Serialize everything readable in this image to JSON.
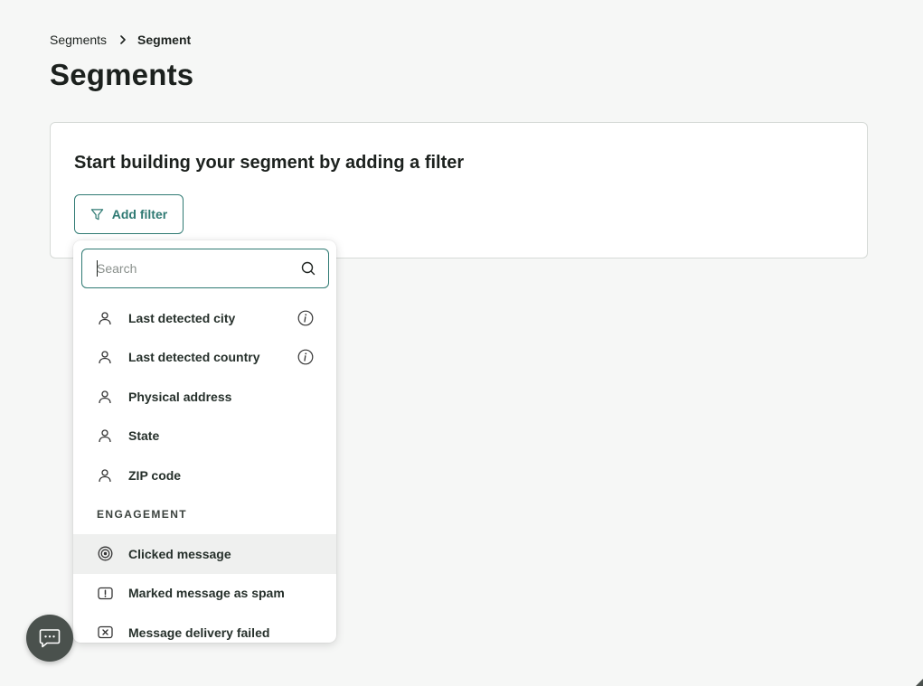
{
  "breadcrumb": {
    "parent": "Segments",
    "current": "Segment"
  },
  "page": {
    "title": "Segments"
  },
  "card": {
    "heading": "Start building your segment by adding a filter",
    "add_filter_label": "Add filter"
  },
  "dropdown": {
    "search_placeholder": "Search",
    "items": [
      {
        "label": "Last detected city",
        "icon": "person-icon",
        "info": true
      },
      {
        "label": "Last detected country",
        "icon": "person-icon",
        "info": true
      },
      {
        "label": "Physical address",
        "icon": "person-icon",
        "info": false
      },
      {
        "label": "State",
        "icon": "person-icon",
        "info": false
      },
      {
        "label": "ZIP code",
        "icon": "person-icon",
        "info": false
      }
    ],
    "section_label": "ENGAGEMENT",
    "engagement_items": [
      {
        "label": "Clicked message",
        "icon": "target-icon",
        "highlighted": true
      },
      {
        "label": "Marked message as spam",
        "icon": "alert-message-icon"
      },
      {
        "label": "Message delivery failed",
        "icon": "failed-message-icon"
      }
    ]
  },
  "colors": {
    "accent": "#2f7a73",
    "chat_button": "#4a514d",
    "background": "#f6f7f6"
  }
}
